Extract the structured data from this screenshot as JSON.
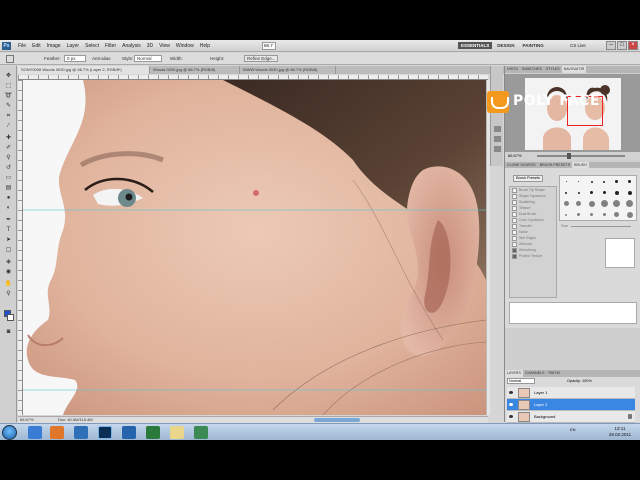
{
  "app": {
    "logo": "Ps",
    "menu": [
      "File",
      "Edit",
      "Image",
      "Layer",
      "Select",
      "Filter",
      "Analysis",
      "3D",
      "View",
      "Window",
      "Help"
    ],
    "zoom": "66.7",
    "workspaces": [
      "ESSENTIALS",
      "DESIGN",
      "PAINTING"
    ],
    "cs_live": "CS Live",
    "window_controls": [
      "–",
      "□",
      "×"
    ]
  },
  "options_bar": {
    "feather_label": "Feather:",
    "feather_value": "0 px",
    "antialias": "Anti-alias",
    "style_label": "Style:",
    "style_value": "Normal",
    "width_label": "Width:",
    "height_label": "Height:",
    "refine_edge": "Refine Edge..."
  },
  "doc_tabs": [
    "SONY0006 Woods 0030.jpg @ 66.7% (Layer 2, RGB/8*)",
    "Woods 0030.jpg @ 66.7% (RGB/8)",
    "WWW.Woods 0030.jpg @ 66.7% (RGB/8)"
  ],
  "canvas": {
    "zoom_status": "66.67%",
    "doc_status": "Doc: 40.6M/115.4M"
  },
  "brand": {
    "name": "POLY FACE"
  },
  "navigator": {
    "tabs": [
      "HISTO",
      "SWATCHES",
      "STYLES",
      "NAVIGATOR"
    ],
    "zoom": "66.67%"
  },
  "brush": {
    "tabs": [
      "CLONE SOURCE",
      "BRUSH PRESETS",
      "BRUSH"
    ],
    "presets_button": "Brush Presets",
    "options": [
      "Brush Tip Shape",
      "Shape Dynamics",
      "Scattering",
      "Texture",
      "Dual Brush",
      "Color Dynamics",
      "Transfer",
      "Noise",
      "Wet Edges",
      "Airbrush",
      "Smoothing",
      "Protect Texture"
    ],
    "checked": [
      false,
      false,
      false,
      false,
      false,
      false,
      false,
      false,
      false,
      false,
      true,
      true
    ],
    "size_label": "Size",
    "brush_sizes": [
      1,
      3,
      5,
      9,
      13,
      19,
      5,
      9,
      13,
      17,
      21,
      27,
      35,
      45,
      65,
      100,
      200,
      300,
      9,
      13,
      19,
      17,
      45,
      65
    ]
  },
  "layers": {
    "tabs": [
      "LAYERS",
      "CHANNELS",
      "PATHS"
    ],
    "blend_mode": "Normal",
    "opacity_label": "Opacity:",
    "opacity_value": "100%",
    "fill_label": "Fill:",
    "fill_value": "100%",
    "items": [
      {
        "name": "Layer 1",
        "selected": false,
        "locked": false
      },
      {
        "name": "Layer 2",
        "selected": true,
        "locked": false
      },
      {
        "name": "Background",
        "selected": false,
        "locked": true
      }
    ]
  },
  "taskbar": {
    "apps": [
      "Internet Explorer",
      "Firefox",
      "Media",
      "Photoshop",
      "Word",
      "Excel",
      "Explorer",
      "Folder",
      "Game"
    ],
    "tray": "EN",
    "time": "13:11",
    "date": "28.02.2011"
  },
  "colors": {
    "accent_selection": "#3a86e3",
    "brand_orange": "#f39a1e",
    "foreground_swatch": "#1e4fd6",
    "workspace_active": "#555555"
  }
}
